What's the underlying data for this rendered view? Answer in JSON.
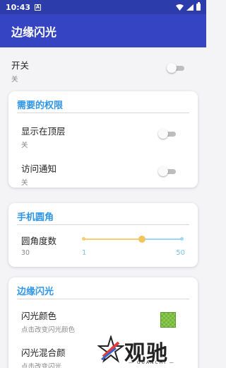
{
  "status_bar": {
    "time": "10:43",
    "notification_letter": "A"
  },
  "app_bar": {
    "title": "边缘闪光"
  },
  "master_switch": {
    "label": "开关",
    "state": "关",
    "on": false
  },
  "permissions_card": {
    "title": "需要的权限",
    "items": [
      {
        "label": "显示在顶层",
        "state": "关",
        "on": false
      },
      {
        "label": "访问通知",
        "state": "关",
        "on": false
      }
    ]
  },
  "corner_card": {
    "title": "手机圆角",
    "label": "圆角度数",
    "value": "30",
    "min_label": "1",
    "max_label": "50",
    "slider_value": 30,
    "slider_min": 1,
    "slider_max": 50,
    "colors": {
      "fill": "#f5cd73",
      "track": "#9dd6f7"
    }
  },
  "flash_card": {
    "title": "边缘闪光",
    "color_item": {
      "label": "闪光颜色",
      "sub": "点击改变闪光颜色",
      "color": "#8fc750"
    },
    "blend_item": {
      "label": "闪光混合颜",
      "sub": "点击改变闪光"
    }
  },
  "watermark": {
    "text": "观驰",
    "sub": "— GUANCHI —"
  },
  "colors": {
    "status_bar": "#2c3cab",
    "app_bar": "#3444c2",
    "accent": "#2f95e6"
  }
}
